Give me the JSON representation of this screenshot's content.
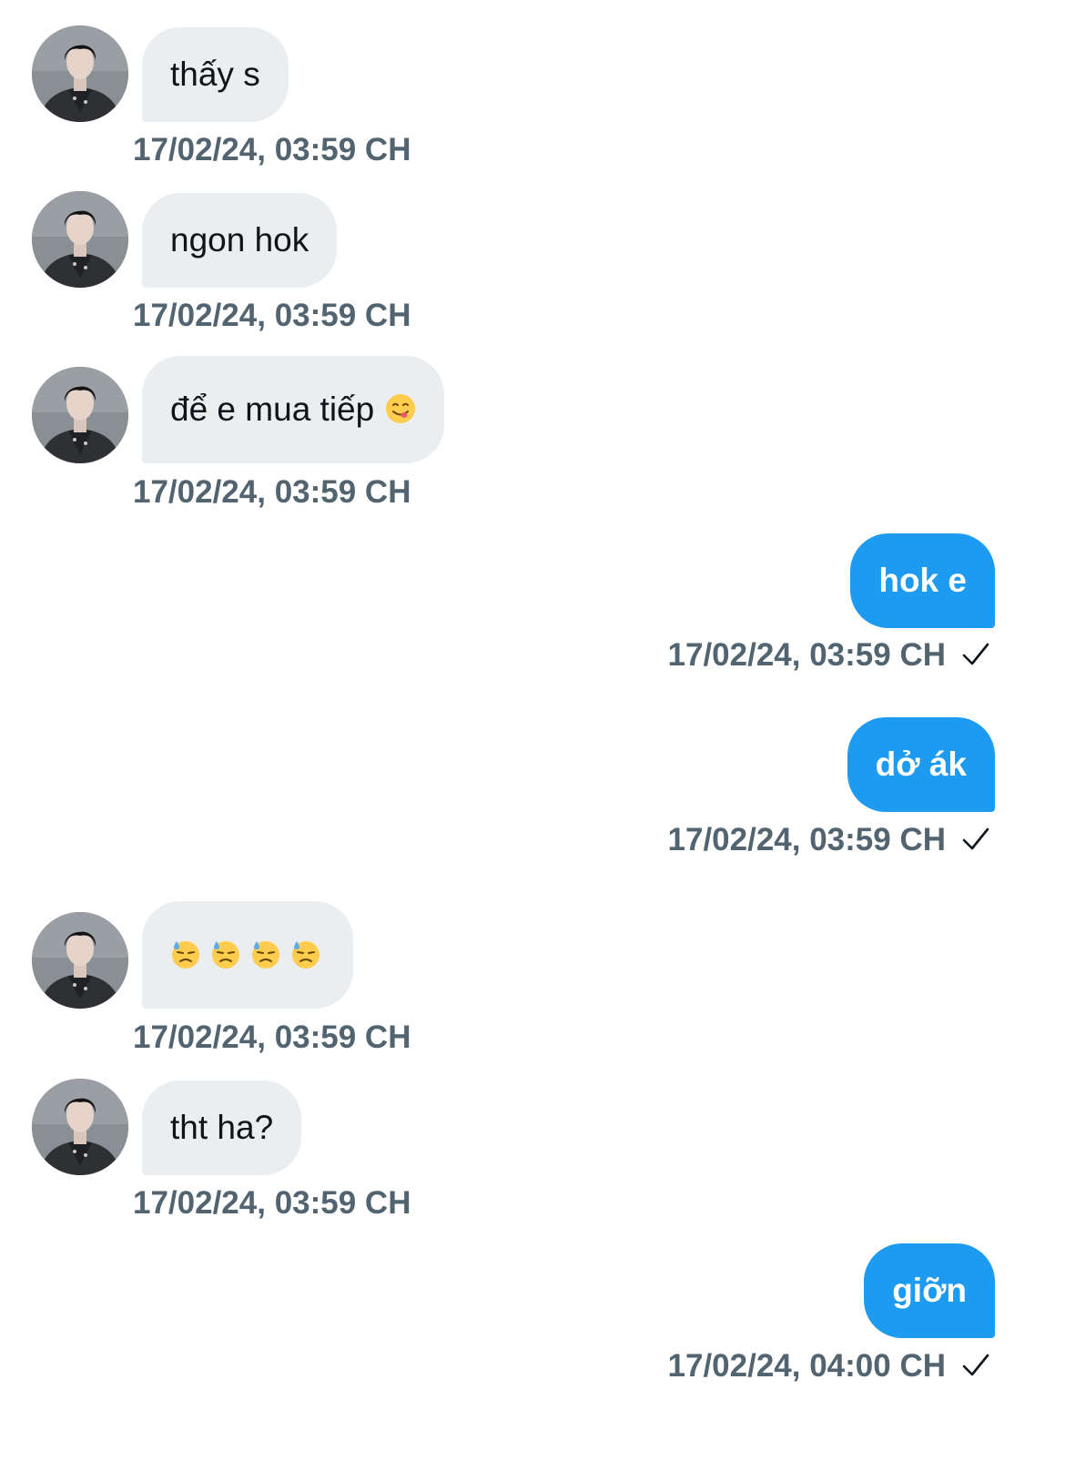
{
  "colors": {
    "incoming_bubble": "#ebeef1",
    "outgoing_bubble": "#1d9bf0",
    "timestamp": "#536471"
  },
  "messages": [
    {
      "direction": "incoming",
      "text": "thấy s",
      "time": "17/02/24, 03:59 CH"
    },
    {
      "direction": "incoming",
      "text": "ngon hok",
      "time": "17/02/24, 03:59 CH"
    },
    {
      "direction": "incoming",
      "text": "để e mua tiếp",
      "emoji": [
        "yum-face-icon"
      ],
      "time": "17/02/24, 03:59 CH"
    },
    {
      "direction": "outgoing",
      "text": "hok e",
      "time": "17/02/24, 03:59 CH",
      "status_icon": "sent-check-icon"
    },
    {
      "direction": "outgoing",
      "text": "dở ák",
      "time": "17/02/24, 03:59 CH",
      "status_icon": "sent-check-icon"
    },
    {
      "direction": "incoming",
      "text": "",
      "emoji": [
        "downcast-sweat-face-icon",
        "downcast-sweat-face-icon",
        "downcast-sweat-face-icon",
        "downcast-sweat-face-icon"
      ],
      "time": "17/02/24, 03:59 CH"
    },
    {
      "direction": "incoming",
      "text": "tht ha?",
      "time": "17/02/24, 03:59 CH"
    },
    {
      "direction": "outgoing",
      "text": "giỡn",
      "time": "17/02/24, 04:00 CH",
      "status_icon": "sent-check-icon"
    }
  ]
}
